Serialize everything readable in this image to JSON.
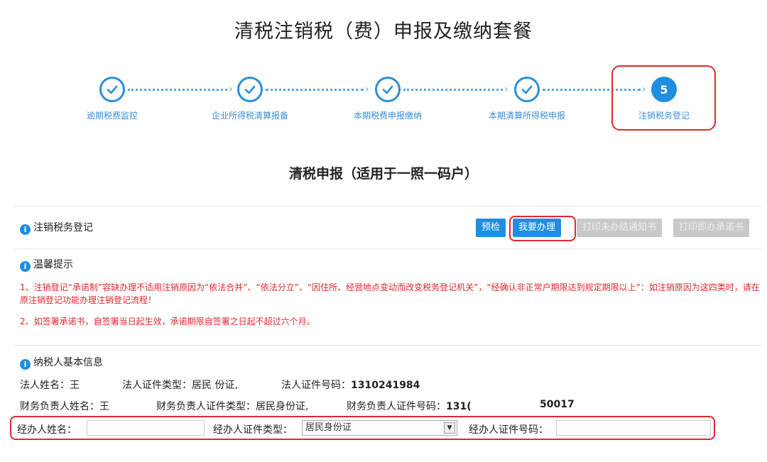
{
  "page_title": "清税注销税（费）申报及缴纳套餐",
  "steps": [
    {
      "label": "逾期税费监控",
      "state": "done"
    },
    {
      "label": "企业所得税清算报备",
      "state": "done"
    },
    {
      "label": "本期税费申报缴纳",
      "state": "done"
    },
    {
      "label": "本期清算所得税申报",
      "state": "done"
    },
    {
      "label": "注销税务登记",
      "state": "current",
      "number": "5"
    }
  ],
  "section_title": "清税申报（适用于一照一码户）",
  "panel": {
    "title": "注销税务登记",
    "buttons": {
      "precheck": "预检",
      "handle": "我要办理",
      "print_notice": "打印未办结通知书",
      "print_commitment": "打印即办承诺书"
    }
  },
  "tips": {
    "title": "温馨提示",
    "line1": "1、注销登记“承诺制”容缺办理不适用注销原因为“依法合并”、“依法分立”、“因住所、经营地点变动而改变税务登记机关”，“经确认非正常户期限达到规定期限以上”：如注销原因为这四类时，请在原注销登记功能办理注销登记流程！",
    "line2": "2、如签署承诺书，自签署当日起生效，承诺期限自签署之日起不超过六个月。"
  },
  "taxpayer": {
    "title": "纳税人基本信息",
    "legal_name_label": "法人姓名：",
    "legal_name": "王",
    "legal_id_type_label": "法人证件类型：",
    "legal_id_type": "居民 份证,",
    "legal_id_no_label": "法人证件号码：",
    "legal_id_no": "1310241984",
    "finance_name_label": "财务负责人姓名：",
    "finance_name": "王",
    "finance_id_type_label": "财务负责人证件类型：",
    "finance_id_type": "居民身份证,",
    "finance_id_no_label": "财务负责人证件号码：",
    "finance_id_no": "131(",
    "finance_id_no_tail": "50017"
  },
  "agent_form": {
    "name_label": "经办人姓名：",
    "name_value": "",
    "id_type_label": "经办人证件类型：",
    "id_type_value": "居民身份证",
    "id_no_label": "经办人证件号码：",
    "id_no_value": ""
  },
  "colors": {
    "accent": "#1f8ee0",
    "highlight": "#e0272e",
    "tip_text": "#e0272e"
  }
}
